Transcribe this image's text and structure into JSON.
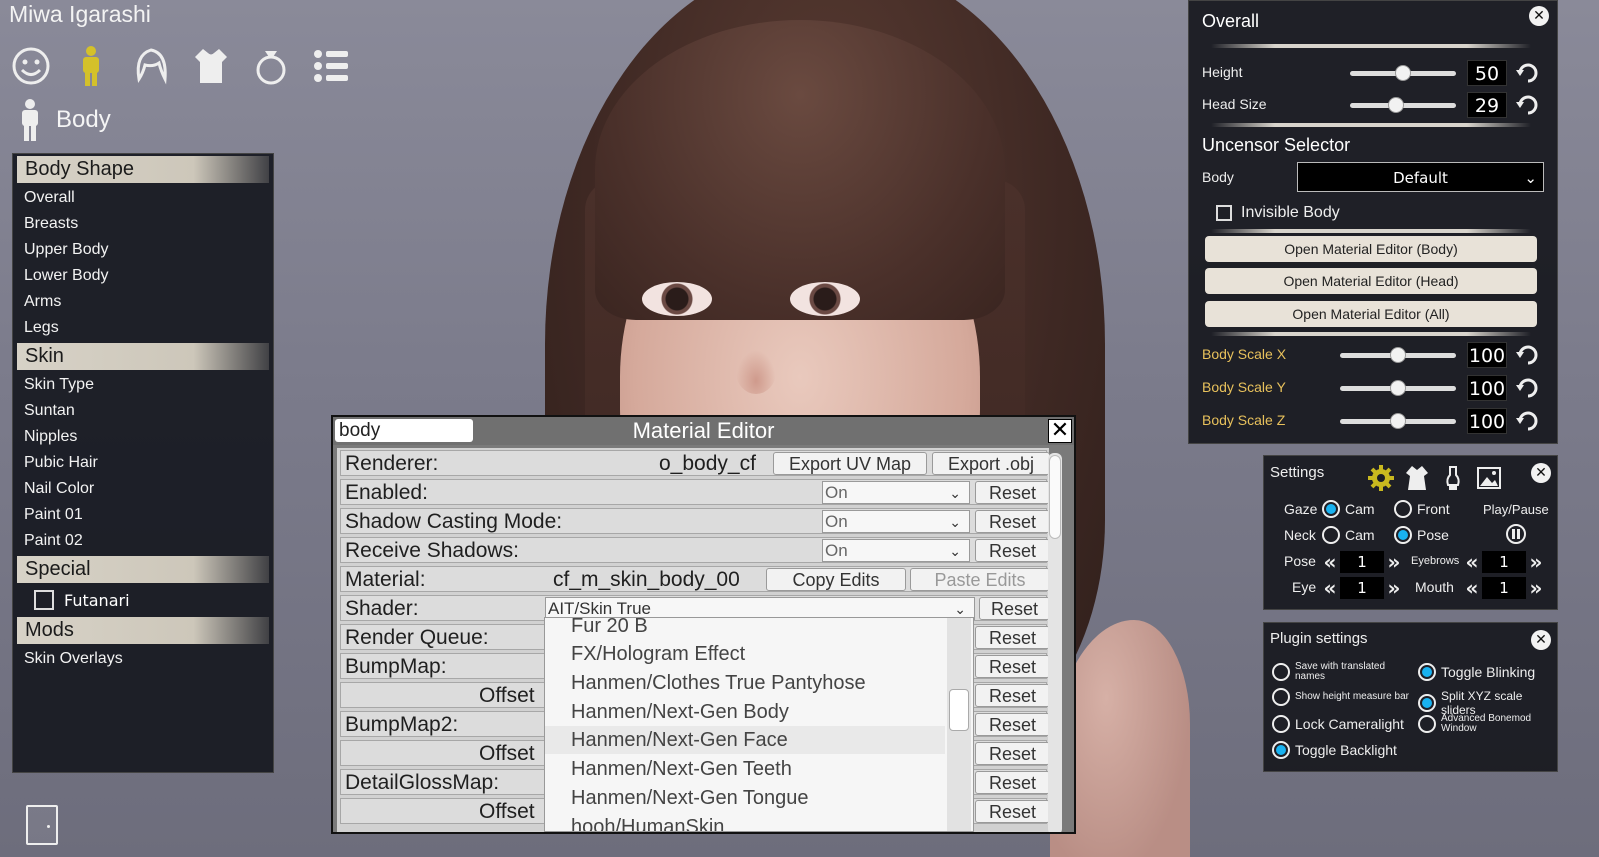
{
  "character_name": "Miwa Igarashi",
  "category_icons": [
    "face-icon",
    "body-figure-icon",
    "hair-icon",
    "clothing-icon",
    "accessory-ring-icon",
    "list-icon"
  ],
  "section": {
    "label": "Body",
    "icon": "body-figure-icon"
  },
  "left_panel": {
    "groups": [
      {
        "title": "Body Shape",
        "items": [
          "Overall",
          "Breasts",
          "Upper Body",
          "Lower Body",
          "Arms",
          "Legs"
        ]
      },
      {
        "title": "Skin",
        "items": [
          "Skin Type",
          "Suntan",
          "Nipples",
          "Pubic Hair",
          "Nail Color",
          "Paint 01",
          "Paint 02"
        ]
      },
      {
        "title": "Special",
        "checkbox": "Futanari"
      },
      {
        "title": "Mods",
        "items": [
          "Skin Overlays"
        ]
      }
    ]
  },
  "overall_panel": {
    "title": "Overall",
    "sliders": [
      {
        "label": "Height",
        "value": "50",
        "fraction": 0.5
      },
      {
        "label": "Head Size",
        "value": "29",
        "fraction": 0.44
      }
    ],
    "uncensor": {
      "title": "Uncensor Selector",
      "body_label": "Body",
      "body_value": "Default",
      "invisible_body_label": "Invisible Body",
      "invisible_body_checked": false
    },
    "buttons": [
      "Open Material Editor (Body)",
      "Open Material Editor (Head)",
      "Open Material Editor (All)"
    ],
    "scale_sliders": [
      {
        "label": "Body Scale X",
        "value": "100",
        "fraction": 0.5
      },
      {
        "label": "Body Scale Y",
        "value": "100",
        "fraction": 0.5
      },
      {
        "label": "Body Scale Z",
        "value": "100",
        "fraction": 0.5
      }
    ]
  },
  "settings_panel": {
    "title": "Settings",
    "gaze_label": "Gaze",
    "neck_label": "Neck",
    "gaze_options": [
      "Cam",
      "Front"
    ],
    "gaze_selected": "Cam",
    "neck_options": [
      "Cam",
      "Pose"
    ],
    "neck_selected": "Pose",
    "play_pause_label": "Play/Pause",
    "pose_label": "Pose",
    "pose_value": "1",
    "eyebrows_label": "Eyebrows",
    "eyebrows_value": "1",
    "eye_label": "Eye",
    "eye_value": "1",
    "mouth_label": "Mouth",
    "mouth_value": "1",
    "tab_icons": [
      "gear-icon",
      "dress-icon",
      "light-bulb-icon",
      "image-icon"
    ]
  },
  "plugin_panel": {
    "title": "Plugin settings",
    "options": [
      {
        "label": "Save with translated names",
        "on": false
      },
      {
        "label": "Toggle Blinking",
        "on": true
      },
      {
        "label": "Show height measure bar",
        "on": false
      },
      {
        "label": "Split XYZ scale sliders",
        "on": true
      },
      {
        "label": "Lock Cameralight",
        "on": false
      },
      {
        "label": "Advanced Bonemod Window",
        "on": false
      },
      {
        "label": "Toggle Backlight",
        "on": true
      }
    ]
  },
  "material_editor": {
    "title": "Material Editor",
    "filter_value": "body",
    "close_symbol": "✕",
    "rows": {
      "renderer": {
        "label": "Renderer:",
        "value": "o_body_cf",
        "btn1": "Export UV Map",
        "btn2": "Export .obj"
      },
      "enabled": {
        "label": "Enabled:",
        "value": "On",
        "reset": "Reset"
      },
      "shadow_casting": {
        "label": "Shadow Casting Mode:",
        "value": "On",
        "reset": "Reset"
      },
      "receive_shadows": {
        "label": "Receive Shadows:",
        "value": "On",
        "reset": "Reset"
      },
      "material": {
        "label": "Material:",
        "value": "cf_m_skin_body_00",
        "btn1": "Copy Edits",
        "btn2": "Paste Edits"
      },
      "shader": {
        "label": "Shader:",
        "value": "AIT/Skin True",
        "reset": "Reset"
      },
      "render_queue": {
        "label": "Render Queue:",
        "reset": "Reset"
      },
      "bumpmap": {
        "label": "BumpMap:",
        "reset": "Reset"
      },
      "bumpmap_offset": {
        "label": "Offset",
        "reset": "Reset"
      },
      "bumpmap2": {
        "label": "BumpMap2:",
        "reset": "Reset"
      },
      "bumpmap2_offset": {
        "label": "Offset",
        "reset": "Reset"
      },
      "detailgloss": {
        "label": "DetailGlossMap:",
        "reset": "Reset"
      },
      "detailgloss_offset": {
        "label": "Offset",
        "reset": "Reset"
      }
    },
    "shader_options": [
      "Fur 20 B",
      "FX/Hologram Effect",
      "Hanmen/Clothes True Pantyhose",
      "Hanmen/Next-Gen Body",
      "Hanmen/Next-Gen Face",
      "Hanmen/Next-Gen Teeth",
      "Hanmen/Next-Gen Tongue",
      "hooh/HumanSkin"
    ],
    "shader_highlighted": "Hanmen/Next-Gen Face"
  },
  "colors": {
    "accent_blue": "#19b2f0",
    "label_gold": "#e8c15c",
    "icon_yellow": "#d4c12a"
  }
}
